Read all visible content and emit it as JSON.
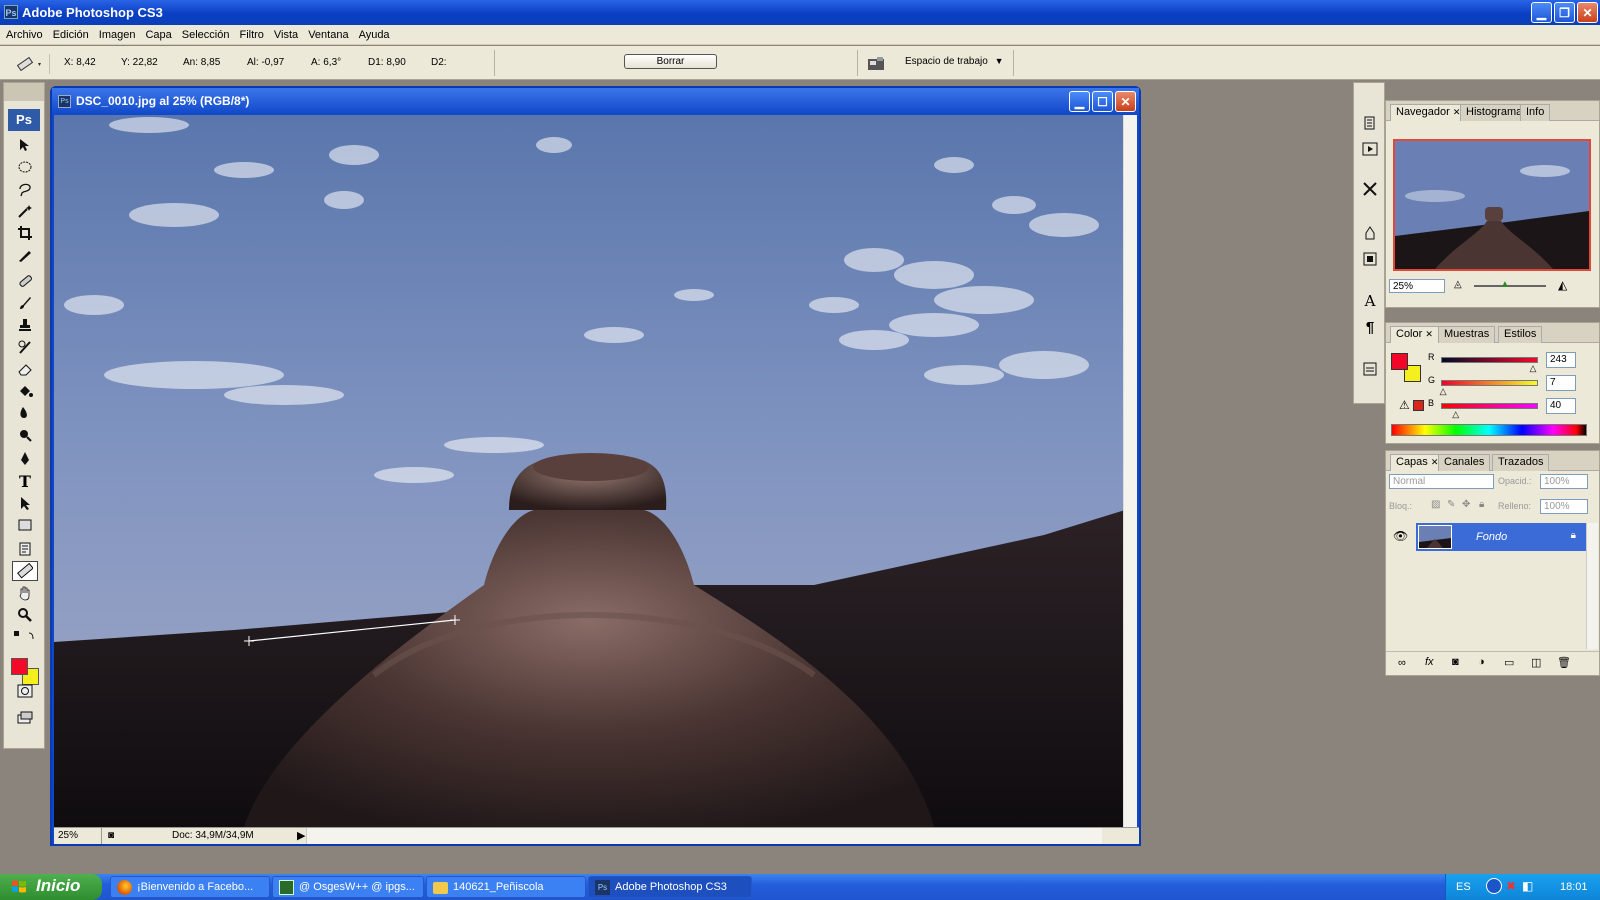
{
  "app": {
    "title": "Adobe Photoshop CS3"
  },
  "menu": [
    "Archivo",
    "Edición",
    "Imagen",
    "Capa",
    "Selección",
    "Filtro",
    "Vista",
    "Ventana",
    "Ayuda"
  ],
  "options": {
    "x": "X: 8,42",
    "y": "Y: 22,82",
    "an": "An: 8,85",
    "al": "Al: -0,97",
    "a": "A: 6,3°",
    "d1": "D1: 8,90",
    "d2": "D2:",
    "clear_label": "Borrar",
    "workspace_label": "Espacio de trabajo"
  },
  "toolbox": {
    "logo": "Ps",
    "fg_color": "#f30a28",
    "bg_color": "#f5ef1e"
  },
  "document": {
    "title": "DSC_0010.jpg al 25% (RGB/8*)",
    "zoom": "25%",
    "doc_size": "Doc: 34,9M/34,9M",
    "icon": "ps-doc-icon"
  },
  "navigator": {
    "tabs": [
      "Navegador",
      "Histograma",
      "Info"
    ],
    "zoom": "25%"
  },
  "color_panel": {
    "tabs": [
      "Color",
      "Muestras",
      "Estilos"
    ],
    "r_label": "R",
    "g_label": "G",
    "b_label": "B",
    "r": "243",
    "g": "7",
    "b": "40",
    "r_level": 0.953,
    "g_level": 0.027,
    "b_level": 0.157,
    "fg_color": "#f30728",
    "bg_color": "#f5ef1e"
  },
  "layers_panel": {
    "tabs": [
      "Capas",
      "Canales",
      "Trazados"
    ],
    "blend_mode": "Normal",
    "opacity_label": "Opacid.:",
    "opacity": "100%",
    "lock_label": "Bloq.:",
    "fill_label": "Relleno:",
    "fill": "100%",
    "layers": [
      {
        "name": "Fondo",
        "visible": true,
        "locked": true
      }
    ]
  },
  "taskbar": {
    "start_label": "Inicio",
    "items": [
      {
        "label": "¡Bienvenido a Facebo...",
        "icon": "firefox-icon"
      },
      {
        "label": "@ OsgesW++ @ ipgs...",
        "icon": "app-icon"
      },
      {
        "label": "140621_Peñiscola",
        "icon": "folder-icon"
      },
      {
        "label": "Adobe Photoshop CS3",
        "icon": "photoshop-icon",
        "active": true
      }
    ],
    "lang": "ES",
    "time": "18:01"
  }
}
